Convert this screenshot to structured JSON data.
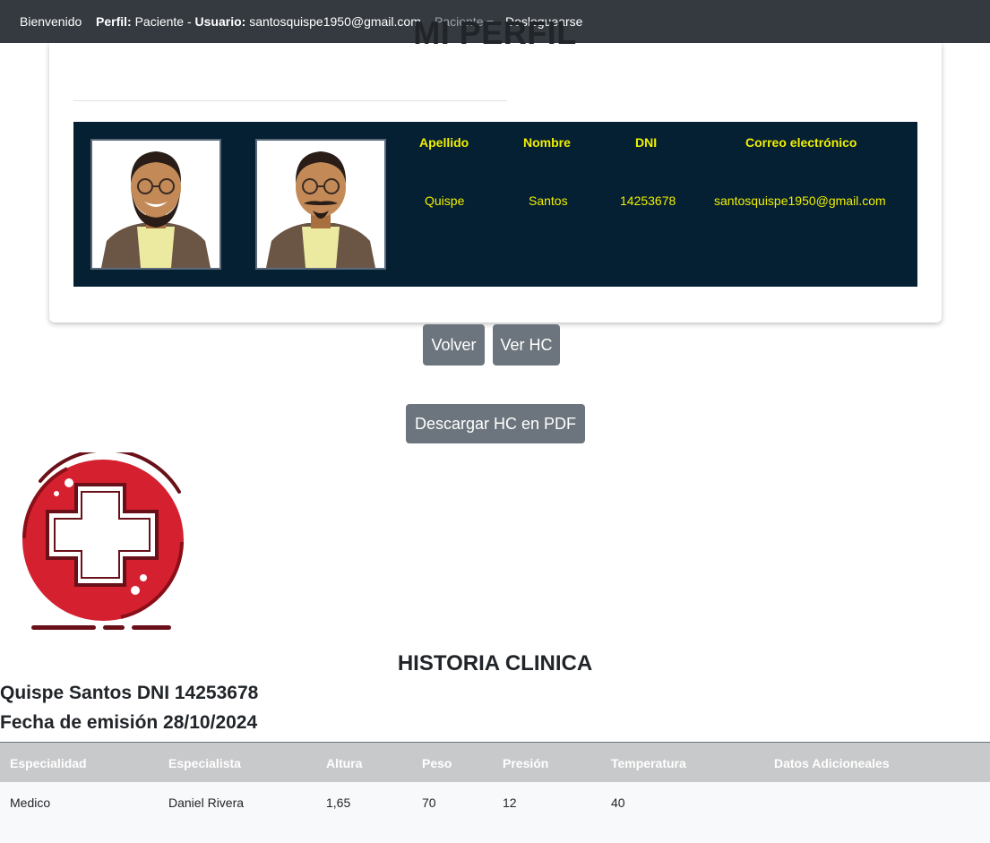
{
  "navbar": {
    "welcome": "Bienvenido",
    "perfil_label": "Perfil:",
    "perfil_value": "Paciente",
    "separator": "-",
    "usuario_label": "Usuario:",
    "usuario_value": "santosquispe1950@gmail.com",
    "menu_paciente": "Paciente",
    "logout": "Desloguearse"
  },
  "profile": {
    "title": "MI PERFIL",
    "headers": {
      "apellido": "Apellido",
      "nombre": "Nombre",
      "dni": "DNI",
      "correo": "Correo electrónico"
    },
    "values": {
      "apellido": "Quispe",
      "nombre": "Santos",
      "dni": "14253678",
      "correo": "santosquispe1950@gmail.com"
    }
  },
  "buttons": {
    "volver": "Volver",
    "ver_hc": "Ver HC",
    "descargar": "Descargar HC en PDF"
  },
  "historia": {
    "title": "HISTORIA CLINICA",
    "paciente_line": "Quispe Santos DNI 14253678",
    "fecha_line": "Fecha de emisión 28/10/2024",
    "columns": [
      "Especialidad",
      "Especialista",
      "Altura",
      "Peso",
      "Presión",
      "Temperatura",
      "Datos Adicioneales"
    ],
    "rows": [
      [
        "Medico",
        "Daniel Rivera",
        "1,65",
        "70",
        "12",
        "40",
        ""
      ]
    ]
  },
  "colors": {
    "navbar": "#343a40",
    "panel": "#051f33",
    "panel_text": "#f0f000",
    "button": "#6c757d",
    "logo_red": "#d4202f"
  }
}
